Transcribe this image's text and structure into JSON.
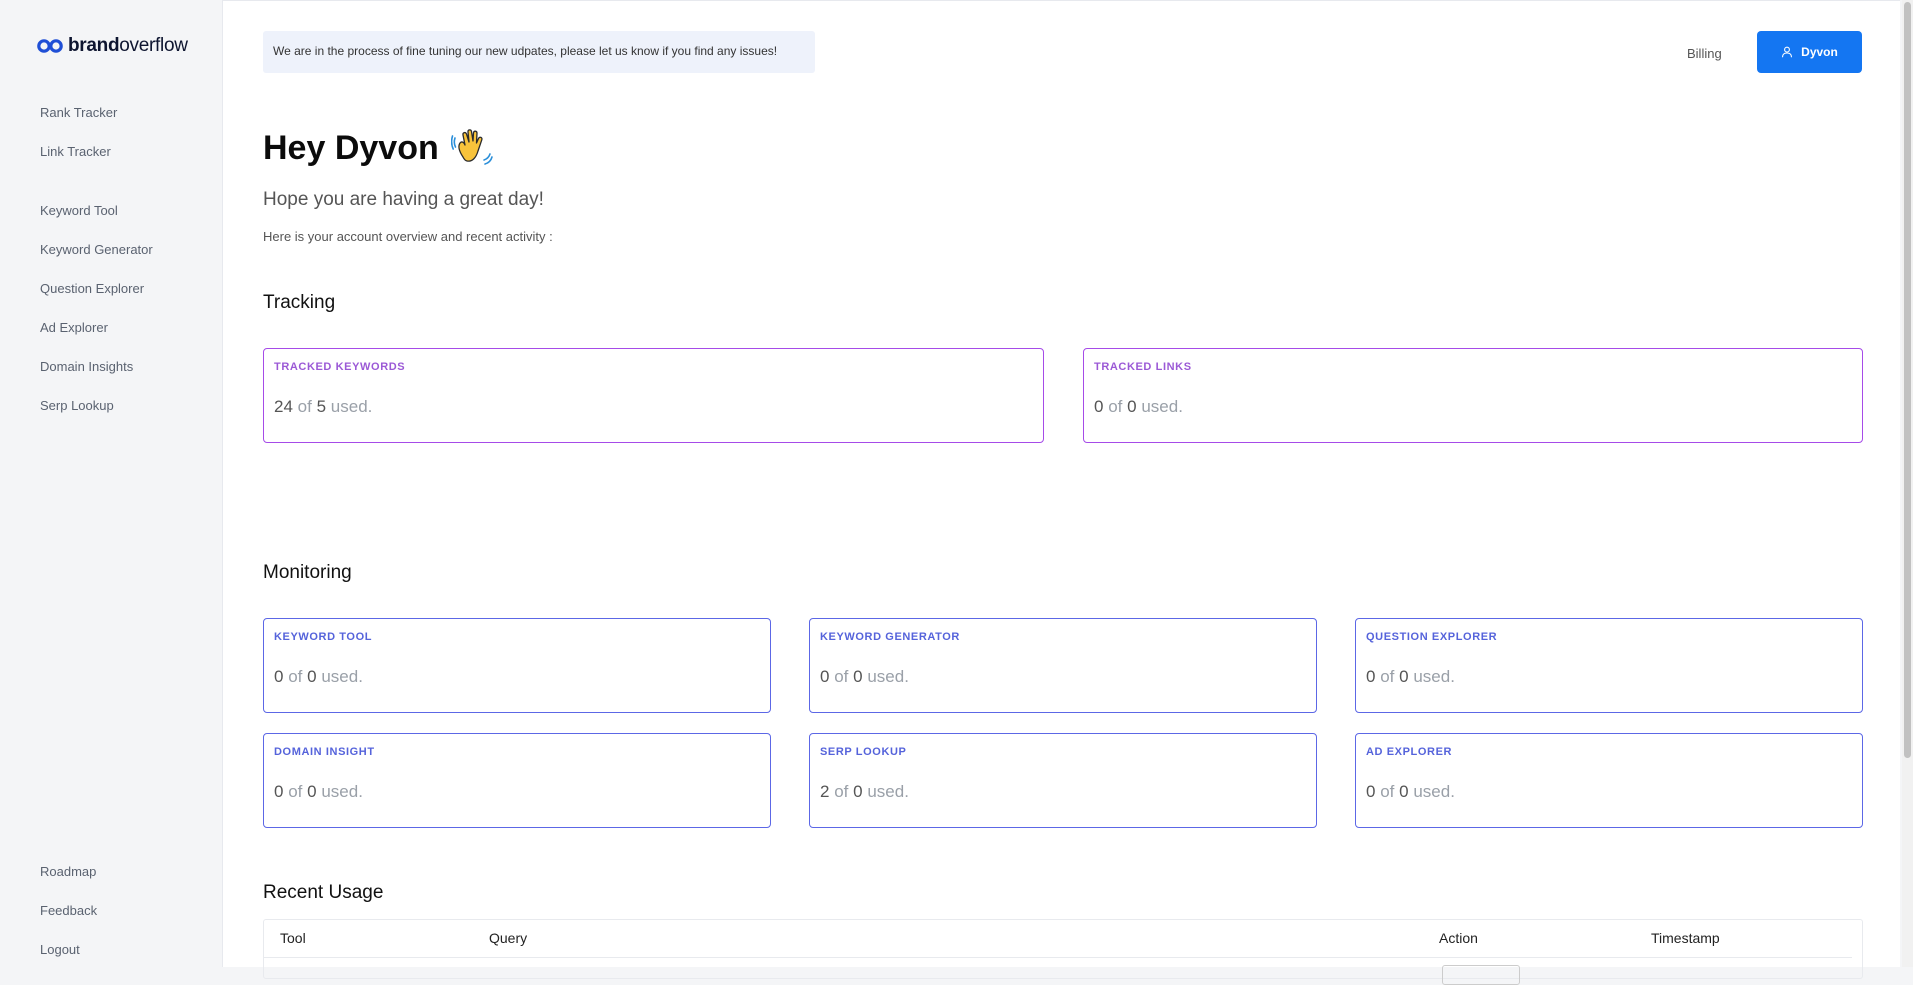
{
  "brand": {
    "bold": "brand",
    "light": "overflow",
    "icon": "infinity-logo-icon",
    "color": "#1f4fd6"
  },
  "nav": {
    "tracking": [
      "Rank Tracker",
      "Link Tracker"
    ],
    "tools": [
      "Keyword Tool",
      "Keyword Generator",
      "Question Explorer",
      "Ad Explorer",
      "Domain Insights",
      "Serp Lookup"
    ],
    "footer": [
      "Roadmap",
      "Feedback",
      "Logout"
    ]
  },
  "header": {
    "notice": "We are in the process of fine tuning our new udpates, please let us know if you find any issues!",
    "billing": "Billing",
    "user_name": "Dyvon",
    "user_icon": "user-icon",
    "accent": "#1476f2"
  },
  "greeting": {
    "title": "Hey Dyvon",
    "emoji_icon": "waving-hand-icon",
    "subtitle": "Hope you are having a great day!",
    "overview": "Here is your account overview and recent activity :"
  },
  "tracking": {
    "heading": "Tracking",
    "color": "#a64be8",
    "cards": [
      {
        "label": "TRACKED KEYWORDS",
        "used": "24",
        "of": "of",
        "total": "5",
        "suffix": "used."
      },
      {
        "label": "TRACKED LINKS",
        "used": "0",
        "of": "of",
        "total": "0",
        "suffix": "used."
      }
    ]
  },
  "monitoring": {
    "heading": "Monitoring",
    "color": "#5c67e6",
    "cards": [
      {
        "label": "KEYWORD TOOL",
        "used": "0",
        "of": "of",
        "total": "0",
        "suffix": "used."
      },
      {
        "label": "KEYWORD GENERATOR",
        "used": "0",
        "of": "of",
        "total": "0",
        "suffix": "used."
      },
      {
        "label": "QUESTION EXPLORER",
        "used": "0",
        "of": "of",
        "total": "0",
        "suffix": "used."
      },
      {
        "label": "DOMAIN INSIGHT",
        "used": "0",
        "of": "of",
        "total": "0",
        "suffix": "used."
      },
      {
        "label": "SERP LOOKUP",
        "used": "2",
        "of": "of",
        "total": "0",
        "suffix": "used."
      },
      {
        "label": "AD EXPLORER",
        "used": "0",
        "of": "of",
        "total": "0",
        "suffix": "used."
      }
    ]
  },
  "recent": {
    "heading": "Recent Usage",
    "columns": [
      "Tool",
      "Query",
      "Action",
      "Timestamp"
    ]
  }
}
